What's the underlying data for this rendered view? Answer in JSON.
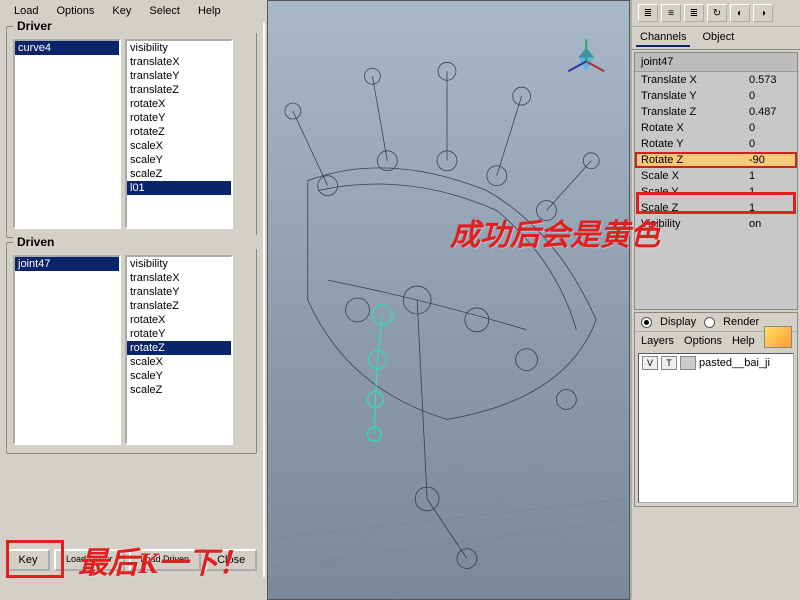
{
  "menu": {
    "items": [
      "Load",
      "Options",
      "Key",
      "Select",
      "Help"
    ]
  },
  "driver": {
    "title": "Driver",
    "left": [
      {
        "label": "curve4",
        "selected": true
      }
    ],
    "right": [
      {
        "label": "visibility"
      },
      {
        "label": "translateX"
      },
      {
        "label": "translateY"
      },
      {
        "label": "translateZ"
      },
      {
        "label": "rotateX"
      },
      {
        "label": "rotateY"
      },
      {
        "label": "rotateZ"
      },
      {
        "label": "scaleX"
      },
      {
        "label": "scaleY"
      },
      {
        "label": "scaleZ"
      },
      {
        "label": "l01",
        "selected": true
      }
    ]
  },
  "driven": {
    "title": "Driven",
    "left": [
      {
        "label": "joint47",
        "selected": true
      }
    ],
    "right": [
      {
        "label": "visibility"
      },
      {
        "label": "translateX"
      },
      {
        "label": "translateY"
      },
      {
        "label": "translateZ"
      },
      {
        "label": "rotateX"
      },
      {
        "label": "rotateY"
      },
      {
        "label": "rotateZ",
        "selected": true
      },
      {
        "label": "scaleX"
      },
      {
        "label": "scaleY"
      },
      {
        "label": "scaleZ"
      }
    ]
  },
  "buttons": {
    "key": "Key",
    "loadDriver": "Load Driver",
    "loadDriven": "Load Driven",
    "close": "Close"
  },
  "channels": {
    "tabs": {
      "channels": "Channels",
      "object": "Object"
    },
    "node": "joint47",
    "attrs": [
      {
        "name": "Translate X",
        "val": "0.573"
      },
      {
        "name": "Translate Y",
        "val": "0"
      },
      {
        "name": "Translate Z",
        "val": "0.487"
      },
      {
        "name": "Rotate X",
        "val": "0"
      },
      {
        "name": "Rotate Y",
        "val": "0"
      },
      {
        "name": "Rotate Z",
        "val": "-90",
        "keyed": true,
        "highlight": true
      },
      {
        "name": "Scale X",
        "val": "1"
      },
      {
        "name": "Scale Y",
        "val": "1"
      },
      {
        "name": "Scale Z",
        "val": "1"
      },
      {
        "name": "Visibility",
        "val": "on"
      }
    ]
  },
  "layers": {
    "modes": {
      "display": "Display",
      "render": "Render"
    },
    "tabs": [
      "Layers",
      "Options",
      "Help"
    ],
    "entry": {
      "vis": "V",
      "type": "T",
      "name": "pasted__bai_ji"
    }
  },
  "annotations": {
    "right": "成功后会是黄色",
    "bottom": "最后K一下！"
  }
}
